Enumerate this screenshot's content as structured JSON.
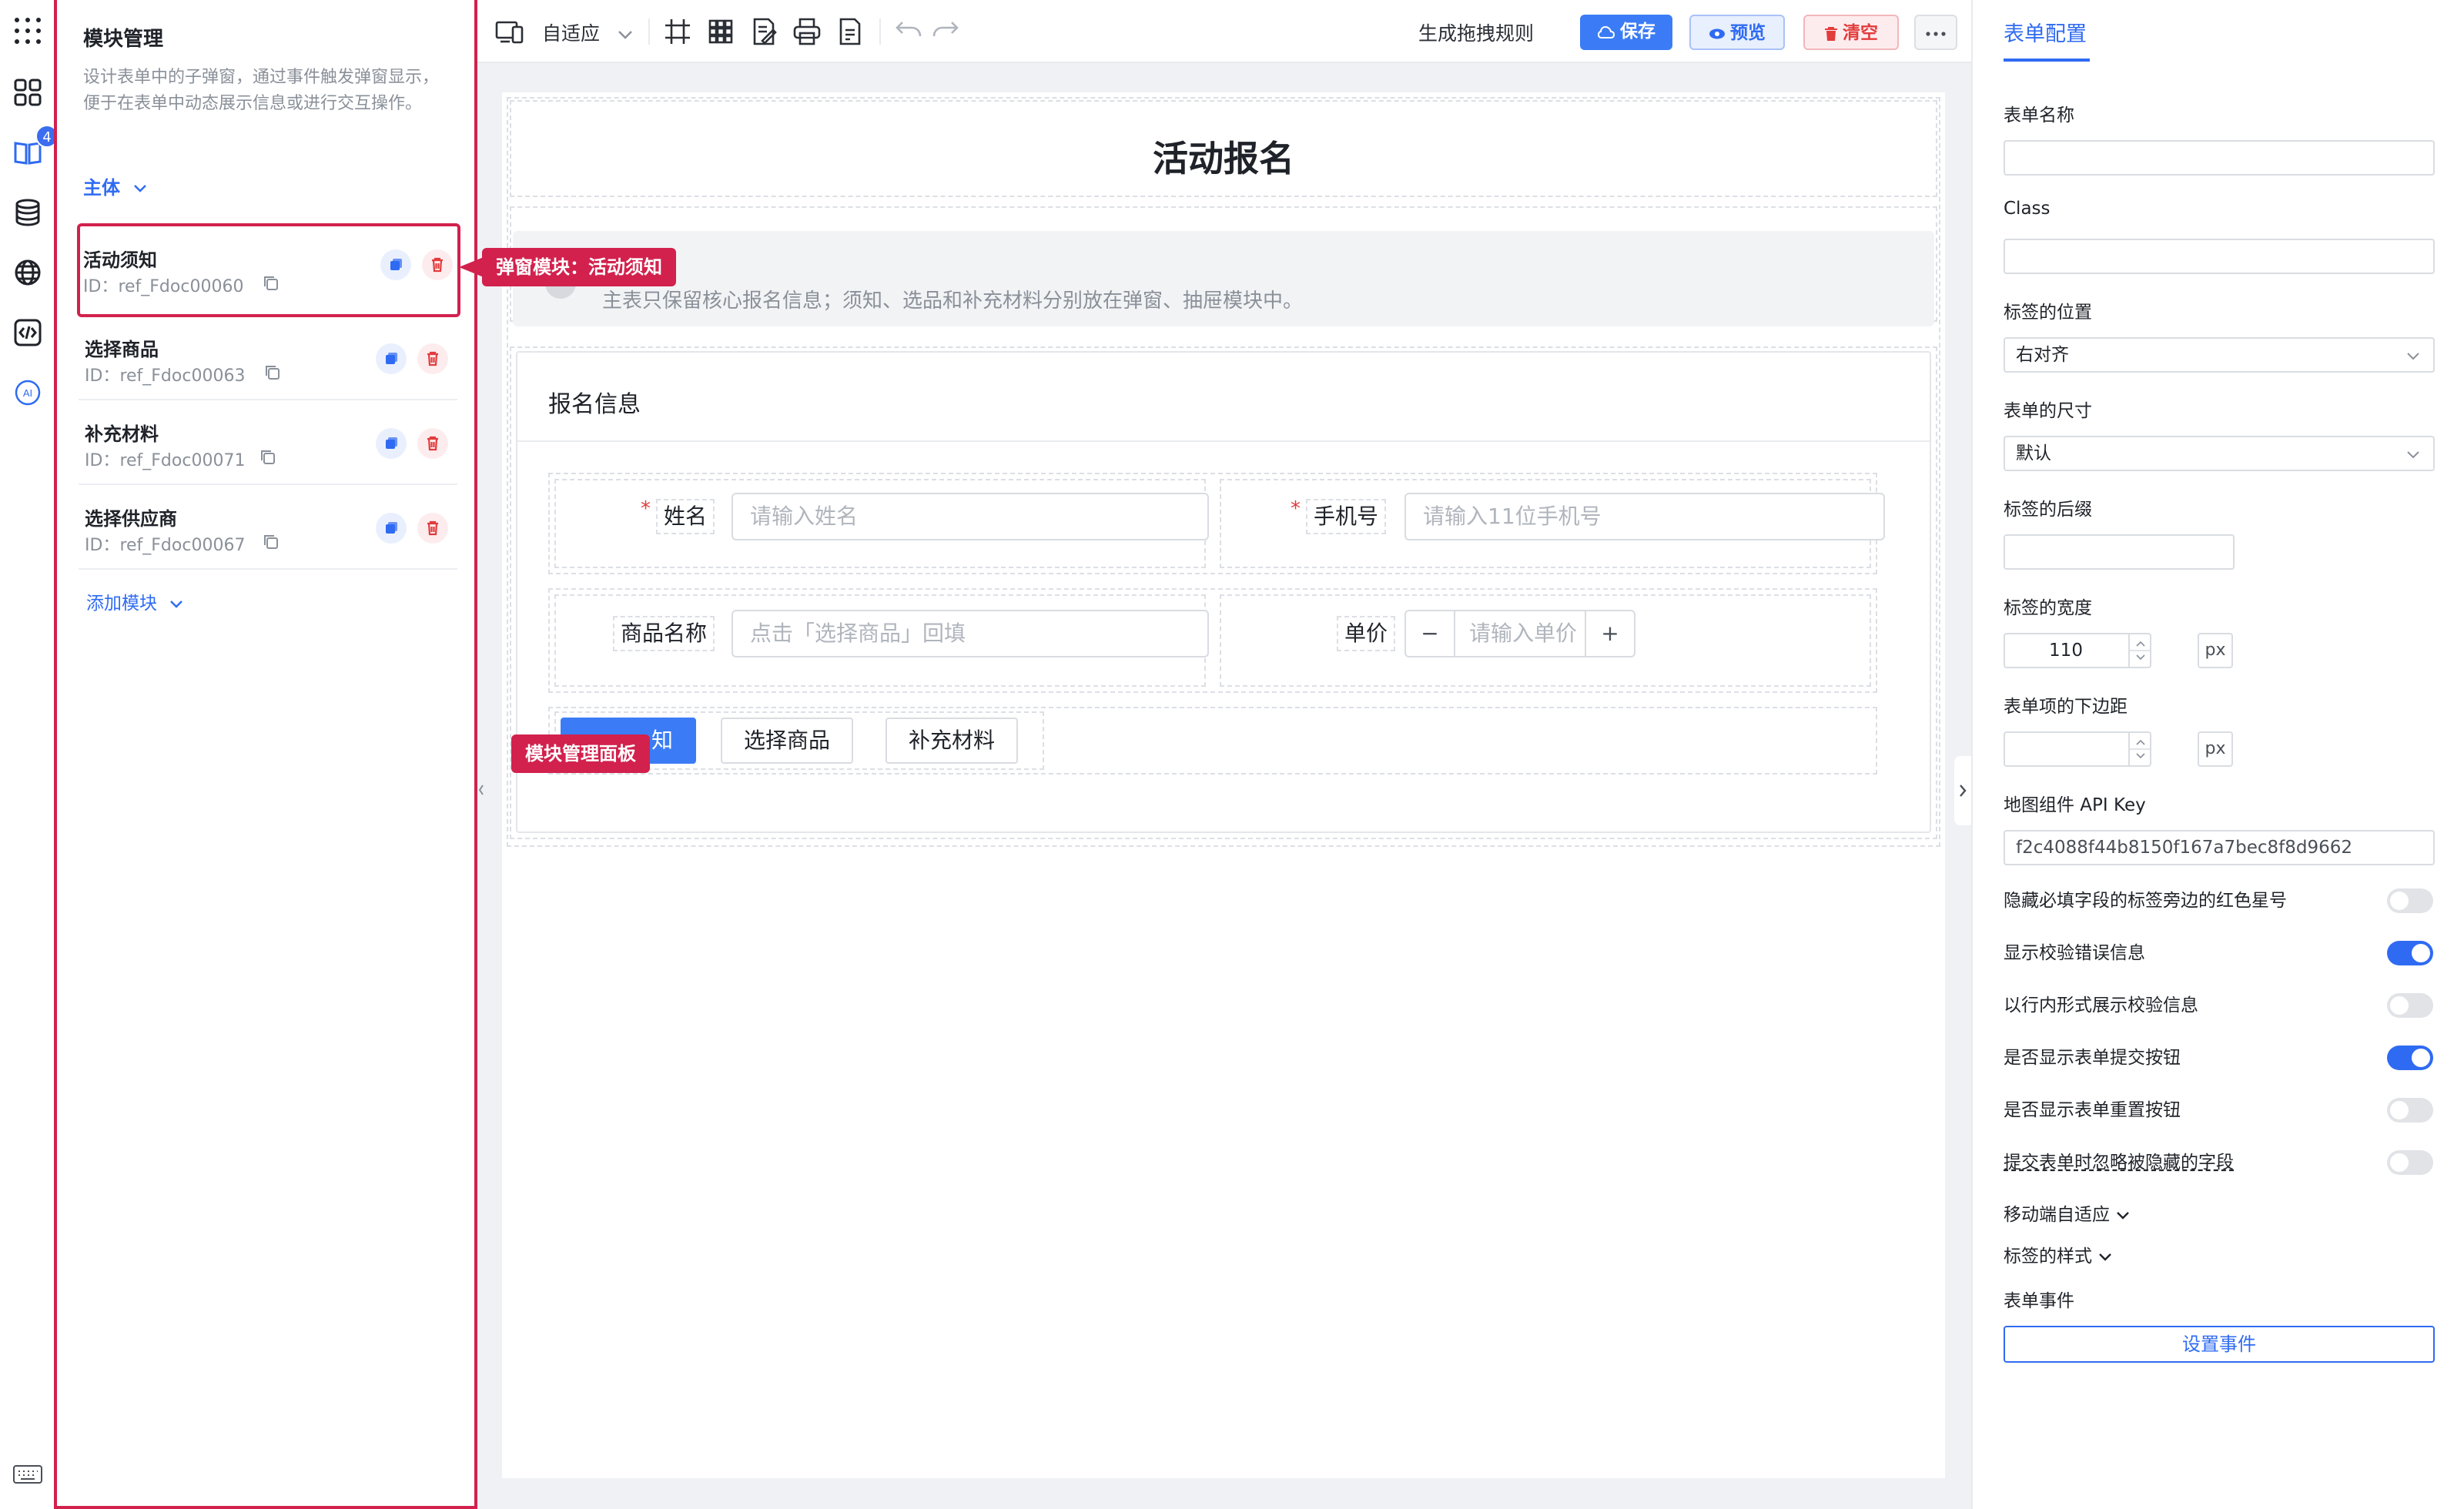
{
  "module_panel": {
    "title": "模块管理",
    "description": "设计表单中的子弹窗，通过事件触发弹窗显示，便于在表单中动态展示信息或进行交互操作。",
    "subject_label": "主体",
    "add_module_label": "添加模块",
    "badge_count": "4",
    "modules": [
      {
        "name": "活动须知",
        "id_label": "ID：",
        "id": "ref_Fdoc00060"
      },
      {
        "name": "选择商品",
        "id_label": "ID：",
        "id": "ref_Fdoc00063"
      },
      {
        "name": "补充材料",
        "id_label": "ID：",
        "id": "ref_Fdoc00071"
      },
      {
        "name": "选择供应商",
        "id_label": "ID：",
        "id": "ref_Fdoc00067"
      }
    ]
  },
  "callouts": {
    "popup_module": "弹窗模块：活动须知",
    "module_panel": "模块管理面板"
  },
  "toolbar": {
    "adapt_label": "自适应",
    "generate_rules": "生成拖拽规则",
    "save": "保存",
    "preview": "预览",
    "clear": "清空"
  },
  "form": {
    "title": "活动报名",
    "notice": "主表只保留核心报名信息；须知、选品和补充材料分别放在弹窗、抽屉模块中。",
    "section_title": "报名信息",
    "fields": {
      "name_label": "姓名",
      "name_placeholder": "请输入姓名",
      "phone_label": "手机号",
      "phone_placeholder": "请输入11位手机号",
      "product_label": "商品名称",
      "product_placeholder": "点击「选择商品」回填",
      "price_label": "单价",
      "price_placeholder": "请输入单价"
    },
    "buttons": {
      "notice_btn_tail": "知",
      "select_product": "选择商品",
      "supplement": "补充材料"
    }
  },
  "right_panel": {
    "tab": "表单配置",
    "form_name_label": "表单名称",
    "class_label": "Class",
    "label_position_label": "标签的位置",
    "label_position_value": "右对齐",
    "form_size_label": "表单的尺寸",
    "form_size_value": "默认",
    "label_suffix_label": "标签的后缀",
    "label_width_label": "标签的宽度",
    "label_width_value": "110",
    "unit_px": "px",
    "item_margin_label": "表单项的下边距",
    "map_key_label": "地图组件 API Key",
    "map_key_value": "f2c4088f44b8150f167a7bec8f8d9662",
    "toggles": [
      {
        "label": "隐藏必填字段的标签旁边的红色星号",
        "on": false
      },
      {
        "label": "显示校验错误信息",
        "on": true
      },
      {
        "label": "以行内形式展示校验信息",
        "on": false
      },
      {
        "label": "是否显示表单提交按钮",
        "on": true
      },
      {
        "label": "是否显示表单重置按钮",
        "on": false
      },
      {
        "label": "提交表单时忽略被隐藏的字段",
        "on": false
      }
    ],
    "mobile_adapt_label": "移动端自适应",
    "label_style_label": "标签的样式",
    "form_events_label": "表单事件",
    "set_events_button": "设置事件"
  }
}
